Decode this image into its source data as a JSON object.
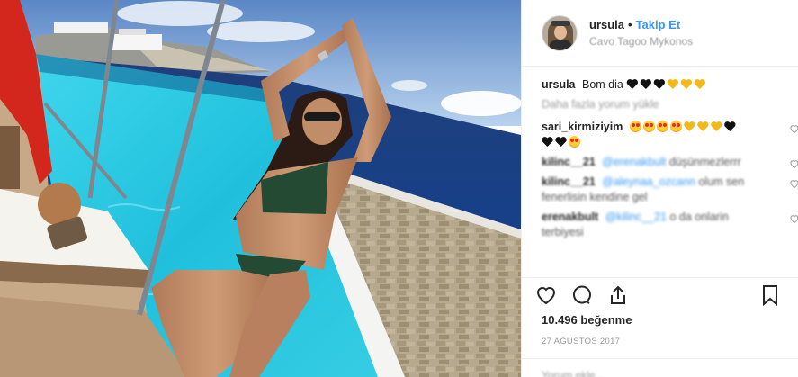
{
  "header": {
    "username": "ursula",
    "separator": "•",
    "follow_label": "Takip Et",
    "location": "Cavo Tagoo Mykonos"
  },
  "caption": {
    "username": "ursula",
    "text": "Bom dia",
    "emoji": [
      "black-heart",
      "black-heart",
      "black-heart",
      "yellow-heart",
      "yellow-heart",
      "yellow-heart"
    ]
  },
  "load_more_label": "Daha fazla yorum yükle",
  "comments": [
    {
      "user": "sari_kirmiziyim",
      "emoji_line1": [
        "heart-eyes",
        "heart-eyes",
        "heart-eyes",
        "heart-eyes",
        "yellow-heart",
        "yellow-heart",
        "yellow-heart",
        "black-heart"
      ],
      "emoji_line2": [
        "black-heart",
        "black-heart",
        "heart-eyes"
      ]
    },
    {
      "user": "kilinc__21",
      "mention": "@erenakbult",
      "text": "düşünmezlerrr"
    },
    {
      "user": "kilinc__21",
      "mention": "@aleynaa_ozcann",
      "text": "olum sen",
      "text2": "fenerlisin kendine gel"
    },
    {
      "user": "erenakbult",
      "mention": "@kilinc__21",
      "text": "o da onlarin",
      "text2": "terbiyesi"
    }
  ],
  "actions": {
    "like": "heart-icon",
    "comment": "comment-icon",
    "share": "share-icon",
    "save": "bookmark-icon"
  },
  "likes_label": "10.496 beğenme",
  "date_label": "27 AĞUSTOS 2017",
  "add_comment_placeholder": "Yorum ekle...",
  "colors": {
    "link_blue": "#3897f0",
    "text": "#262626",
    "muted": "#999999",
    "pool": "#2fc4e0",
    "sea": "#1e4f8a",
    "sky": "#8fb7e6"
  }
}
